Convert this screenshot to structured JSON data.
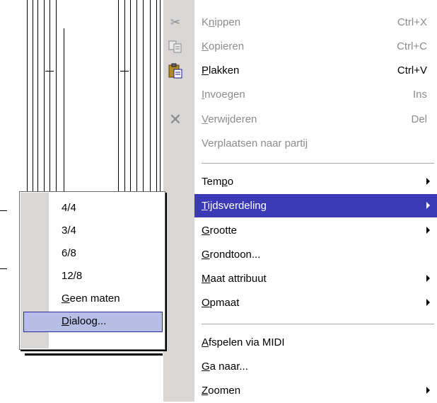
{
  "context_menu": {
    "items": [
      {
        "label_pre": "K",
        "label_u": "n",
        "label_post": "ippen",
        "shortcut": "Ctrl+X",
        "disabled": true,
        "icon": "scissors-icon"
      },
      {
        "label_pre": "",
        "label_u": "K",
        "label_post": "opieren",
        "shortcut": "Ctrl+C",
        "disabled": true,
        "icon": "copy-icon"
      },
      {
        "label_pre": "",
        "label_u": "P",
        "label_post": "lakken",
        "shortcut": "Ctrl+V",
        "disabled": false,
        "icon": "paste-icon"
      },
      {
        "label_pre": "",
        "label_u": "I",
        "label_post": "nvoegen",
        "shortcut": "Ins",
        "disabled": true,
        "icon": ""
      },
      {
        "label_pre": "",
        "label_u": "V",
        "label_post": "erwijderen",
        "shortcut": "Del",
        "disabled": true,
        "icon": "delete-x-icon"
      },
      {
        "label_pre": "Verplaatsen naar partij",
        "label_u": "",
        "label_post": "",
        "shortcut": "",
        "disabled": true,
        "icon": ""
      },
      {
        "label_pre": "Tem",
        "label_u": "p",
        "label_post": "o",
        "shortcut": "",
        "submenu": true
      },
      {
        "label_pre": "",
        "label_u": "T",
        "label_post": "ijdsverdeling",
        "shortcut": "",
        "submenu": true,
        "active": true
      },
      {
        "label_pre": "",
        "label_u": "G",
        "label_post": "rootte",
        "shortcut": "",
        "submenu": true
      },
      {
        "label_pre": "",
        "label_u": "G",
        "label_post": "rondtoon...",
        "shortcut": ""
      },
      {
        "label_pre": "",
        "label_u": "M",
        "label_post": "aat attribuut",
        "shortcut": "",
        "submenu": true
      },
      {
        "label_pre": "",
        "label_u": "O",
        "label_post": "pmaat",
        "shortcut": "",
        "submenu": true
      },
      {
        "label_pre": "",
        "label_u": "A",
        "label_post": "fspelen via MIDI",
        "shortcut": ""
      },
      {
        "label_pre": "",
        "label_u": "G",
        "label_post": "a naar...",
        "shortcut": ""
      },
      {
        "label_pre": "",
        "label_u": "Z",
        "label_post": "oomen",
        "shortcut": "",
        "submenu": true
      }
    ]
  },
  "submenu": {
    "items": [
      {
        "label_pre": "4/4",
        "label_u": "",
        "label_post": ""
      },
      {
        "label_pre": "3/4",
        "label_u": "",
        "label_post": ""
      },
      {
        "label_pre": "6/8",
        "label_u": "",
        "label_post": ""
      },
      {
        "label_pre": "12/8",
        "label_u": "",
        "label_post": ""
      },
      {
        "label_pre": "",
        "label_u": "G",
        "label_post": "een maten"
      },
      {
        "label_pre": "",
        "label_u": "D",
        "label_post": "ialoog...",
        "selected": true
      }
    ]
  },
  "colors": {
    "highlight": "#3a3ab6",
    "gutter": "#d9d6d6",
    "disabled_text": "#8c8c8c",
    "sub_selected": "#b6bee6"
  }
}
